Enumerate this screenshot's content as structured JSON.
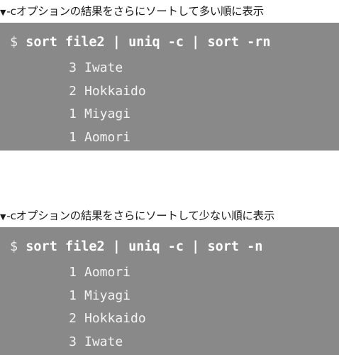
{
  "sections": [
    {
      "caption": "-cオプションの結果をさらにソートして多い順に表示",
      "marker": "▼",
      "prompt": "$",
      "command": "sort file2 | uniq -c | sort -rn",
      "output": [
        {
          "count": "3",
          "name": "Iwate"
        },
        {
          "count": "2",
          "name": "Hokkaido"
        },
        {
          "count": "1",
          "name": "Miyagi"
        },
        {
          "count": "1",
          "name": "Aomori"
        }
      ]
    },
    {
      "caption": "-cオプションの結果をさらにソートして少ない順に表示",
      "marker": "▼",
      "prompt": "$",
      "command": "sort file2 | uniq -c | sort -n",
      "output": [
        {
          "count": "1",
          "name": "Aomori"
        },
        {
          "count": "1",
          "name": "Miyagi"
        },
        {
          "count": "2",
          "name": "Hokkaido"
        },
        {
          "count": "3",
          "name": "Iwate"
        }
      ]
    }
  ],
  "colors": {
    "terminal_bg": "#898989",
    "terminal_text": "#ffffff",
    "caption_text": "#1a1a1a"
  }
}
